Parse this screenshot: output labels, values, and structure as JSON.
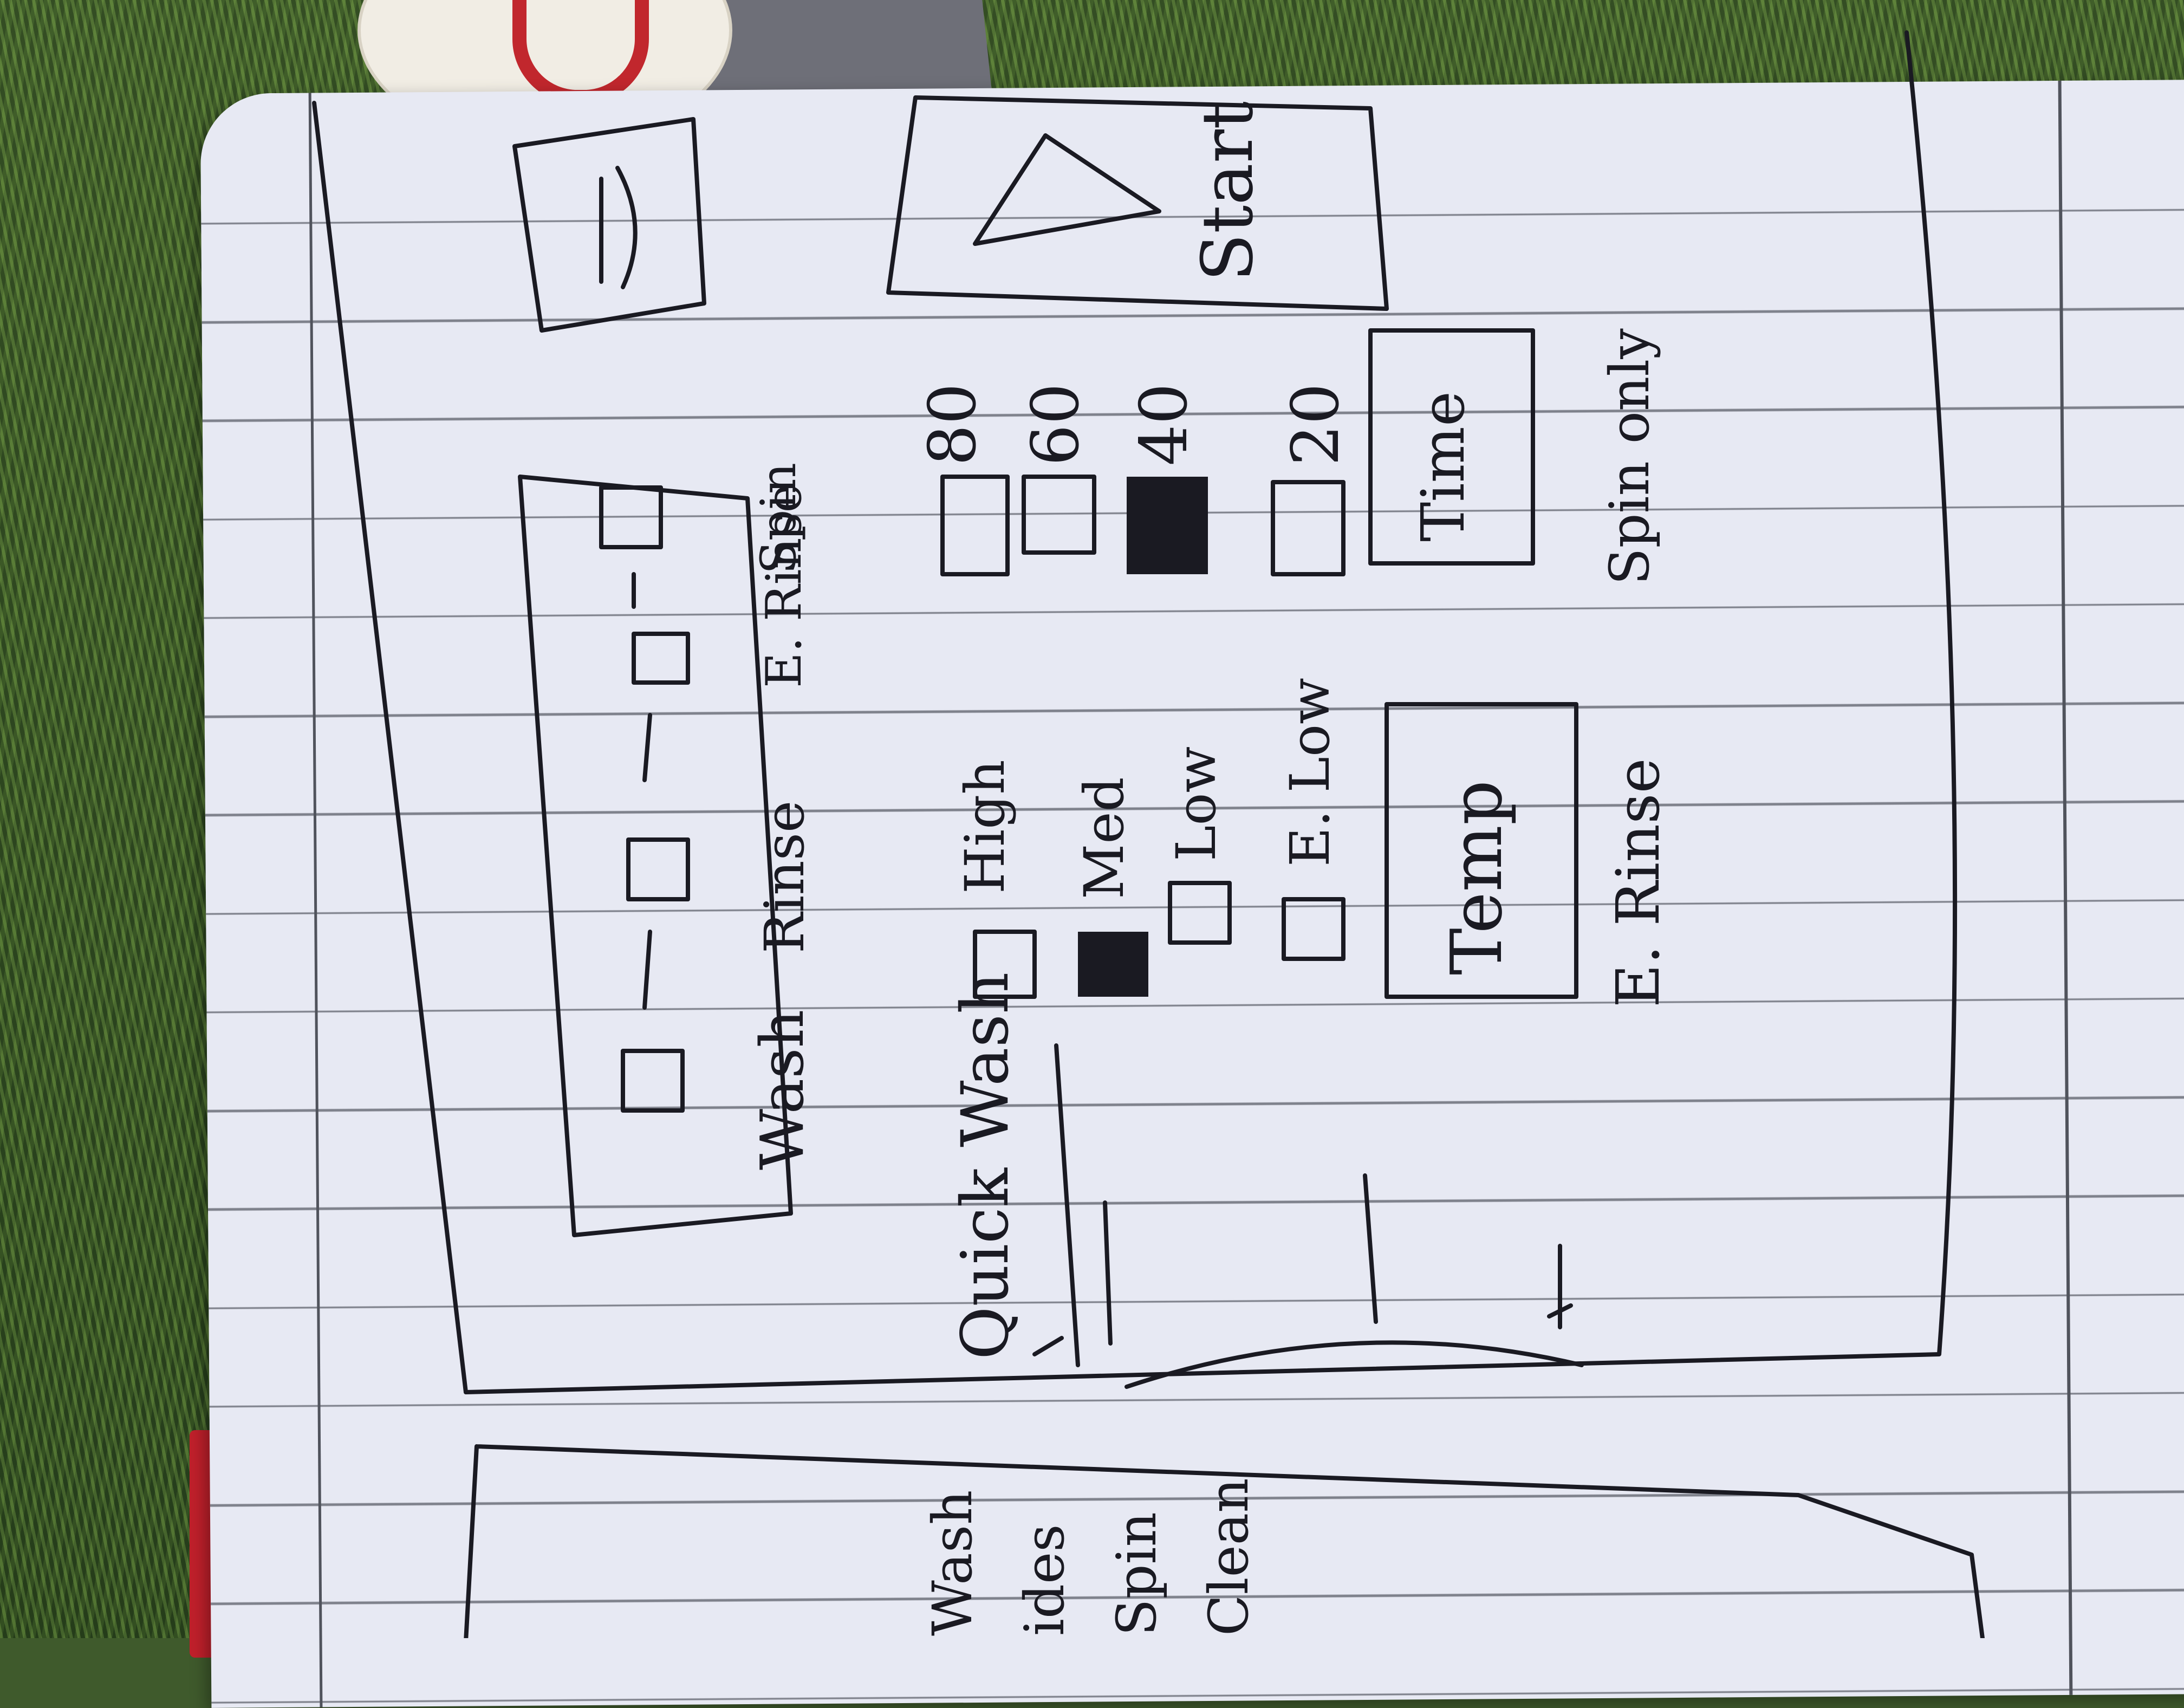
{
  "sketch": {
    "process_labels": [
      "Wash",
      "Rinse",
      "E. Rinse",
      "Spin"
    ],
    "cycle_label": "Quick Wash",
    "temperature_options": [
      "High",
      "Med",
      "Low",
      "E. Low"
    ],
    "temperature_selected": "Med",
    "temperature_button": "Temp",
    "time_options": [
      "80",
      "60",
      "40",
      "20"
    ],
    "time_selected": "40",
    "time_button": "Time",
    "extras": [
      "E. Rinse",
      "Spin only"
    ],
    "start_label": "Start",
    "side_list": [
      "Wash",
      "ides",
      "Spin",
      "Clean"
    ]
  }
}
